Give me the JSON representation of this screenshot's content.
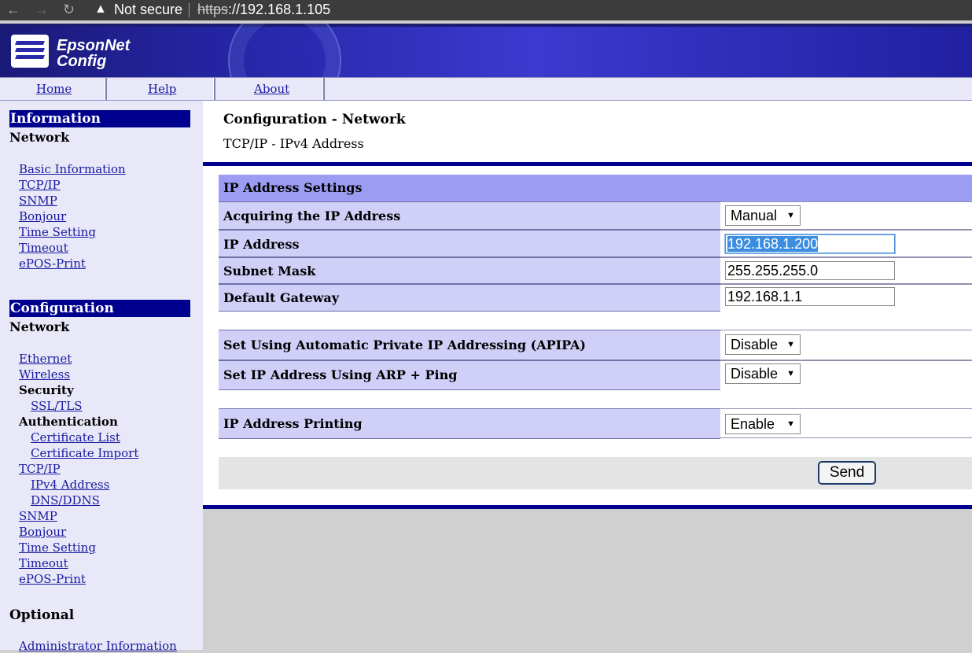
{
  "browser": {
    "back_icon": "arrow-left-icon",
    "forward_icon": "arrow-right-icon",
    "reload_icon": "reload-icon",
    "security_label": "Not secure",
    "url_scheme": "https",
    "url_rest": "://192.168.1.105"
  },
  "banner": {
    "logo_line1": "EpsonNet",
    "logo_line2": "Config"
  },
  "topnav": {
    "home": "Home",
    "help": "Help",
    "about": "About"
  },
  "sidebar": {
    "information": {
      "title": "Information",
      "subtitle": "Network",
      "links": [
        "Basic Information",
        "TCP/IP",
        "SNMP",
        "Bonjour",
        "Time Setting",
        "Timeout",
        "ePOS-Print"
      ]
    },
    "configuration": {
      "title": "Configuration",
      "subtitle": "Network",
      "ethernet": "Ethernet",
      "wireless": "Wireless",
      "security": "Security",
      "ssl_tls": "SSL/TLS",
      "authentication": "Authentication",
      "certificate_list": "Certificate List",
      "certificate_import": "Certificate Import",
      "tcpip": "TCP/IP",
      "ipv4_address": "IPv4 Address",
      "dns_ddns": "DNS/DDNS",
      "snmp": "SNMP",
      "bonjour": "Bonjour",
      "time_setting": "Time Setting",
      "timeout": "Timeout",
      "epos_print": "ePOS-Print"
    },
    "optional": {
      "title": "Optional",
      "admin_info": "Administrator Information"
    }
  },
  "main": {
    "title": "Configuration - Network",
    "subtitle": "TCP/IP - IPv4 Address",
    "table_header": "IP Address Settings",
    "rows": {
      "acquiring": {
        "label": "Acquiring the IP Address",
        "value": "Manual"
      },
      "ip": {
        "label": "IP Address",
        "value": "192.168.1.200"
      },
      "subnet": {
        "label": "Subnet Mask",
        "value": "255.255.255.0"
      },
      "gateway": {
        "label": "Default Gateway",
        "value": "192.168.1.1"
      },
      "apipa": {
        "label": "Set Using Automatic Private IP Addressing (APIPA)",
        "value": "Disable"
      },
      "arp": {
        "label": "Set IP Address Using ARP + Ping",
        "value": "Disable"
      },
      "printing": {
        "label": "IP Address Printing",
        "value": "Enable"
      }
    },
    "send_label": "Send"
  },
  "colors": {
    "nav_blue": "#00008e",
    "row_label_bg": "#cfcff8",
    "table_header_bg": "#9c9cf2",
    "link": "#1a1aa0"
  }
}
